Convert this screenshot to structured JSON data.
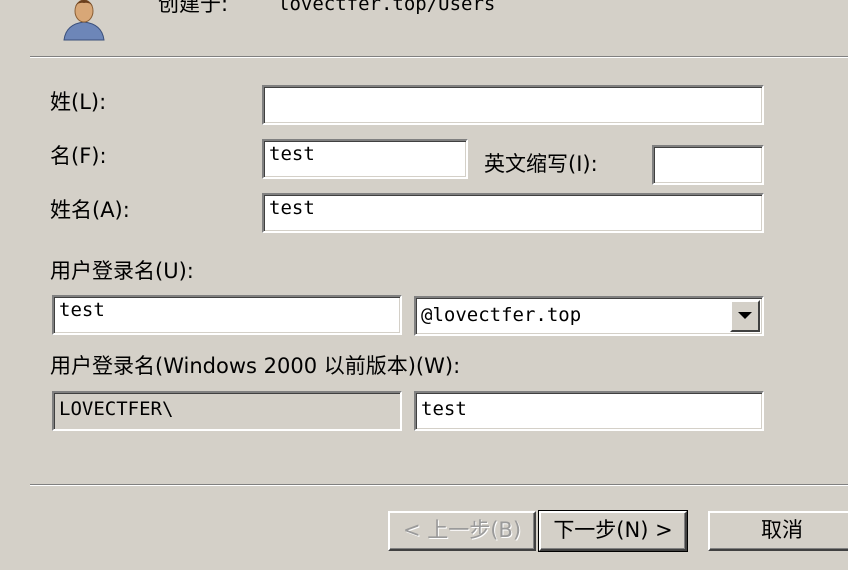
{
  "header": {
    "icon": "user-icon",
    "created_in_label": "创建于:",
    "created_in_value": "lovectfer.top/Users"
  },
  "form": {
    "last_name_label": "姓(L):",
    "last_name_value": "",
    "first_name_label": "名(F):",
    "first_name_value": "test",
    "initials_label": "英文缩写(I):",
    "initials_value": "",
    "full_name_label": "姓名(A):",
    "full_name_value": "test",
    "logon_name_label": "用户登录名(U):",
    "logon_name_value": "test",
    "upn_suffix_value": "@lovectfer.top",
    "pre2000_label": "用户登录名(Windows 2000 以前版本)(W):",
    "pre2000_domain_value": "LOVECTFER\\",
    "pre2000_name_value": "test"
  },
  "buttons": {
    "back_label": "< 上一步(B)",
    "next_label": "下一步(N) >",
    "cancel_label": "取消"
  }
}
